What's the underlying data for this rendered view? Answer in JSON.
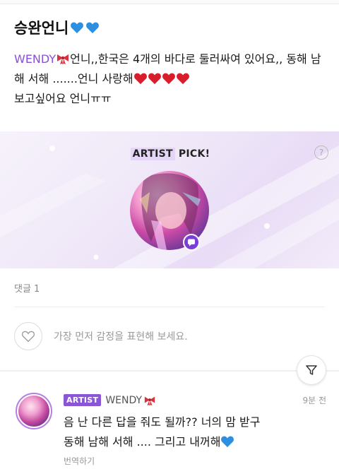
{
  "post": {
    "title": "승완언니",
    "title_emoji": "blue-heart-icon",
    "line1_mention": "WENDY",
    "line1_rest": "언니,,한국은 4개의 바다로 둘러싸여 있어요,, 동해 남해 서해 .......언니 사랑해",
    "line2": "보고싶어요 언니ㅠㅠ"
  },
  "artist_pick": {
    "label_artist": "ARTIST",
    "label_pick": "PICK!",
    "help": "?"
  },
  "comments": {
    "count_label": "댓글 1",
    "emotion_prompt": "가장 먼저 감정을 표현해 보세요."
  },
  "reply": {
    "tag": "ARTIST",
    "name": "WENDY",
    "time": "9분 전",
    "line1": "음 난 다른 답을 줘도 될까?? 너의 맘 받구",
    "line2": "동해 남해 서해 .... 그리고 내꺼해",
    "translate": "번역하기"
  },
  "colors": {
    "accent_purple": "#8b56d6",
    "mention_purple": "#8a4fd6",
    "heart_blue": "#2e8fe0",
    "heart_red": "#d81e2c",
    "ribbon_red": "#d9333d"
  }
}
